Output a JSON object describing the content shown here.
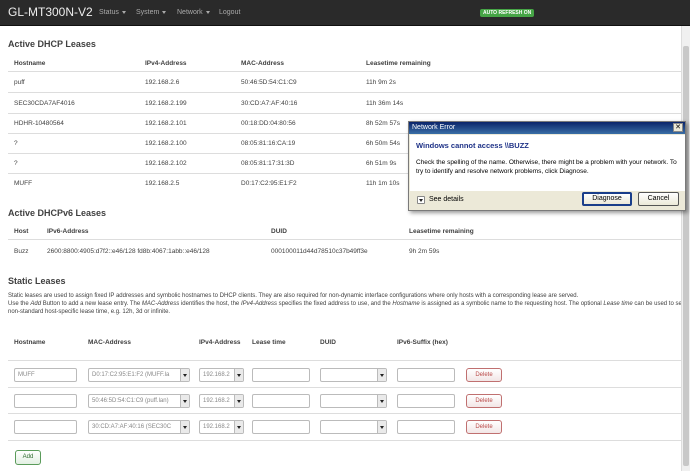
{
  "header": {
    "brand": "GL-MT300N-V2",
    "menus": [
      "Status",
      "System",
      "Network",
      "Logout"
    ],
    "auto_refresh": "AUTO REFRESH ON"
  },
  "dhcp": {
    "title": "Active DHCP Leases",
    "columns": [
      "Hostname",
      "IPv4-Address",
      "MAC-Address",
      "Leasetime remaining"
    ],
    "rows": [
      [
        "puff",
        "192.168.2.6",
        "50:46:5D:54:C1:C9",
        "11h 9m 2s"
      ],
      [
        "SEC30CDA7AF4016",
        "192.168.2.199",
        "30:CD:A7:AF:40:16",
        "11h 36m 14s"
      ],
      [
        "HDHR-10480564",
        "192.168.2.101",
        "00:18:DD:04:80:56",
        "8h 52m 57s"
      ],
      [
        "?",
        "192.168.2.100",
        "08:05:81:16:CA:19",
        "6h 50m 54s"
      ],
      [
        "?",
        "192.168.2.102",
        "08:05:81:17:31:3D",
        "6h 51m 9s"
      ],
      [
        "MUFF",
        "192.168.2.5",
        "D0:17:C2:95:E1:F2",
        "11h 1m 10s"
      ]
    ]
  },
  "dhcpv6": {
    "title": "Active DHCPv6 Leases",
    "columns": [
      "Host",
      "IPv6-Address",
      "DUID",
      "Leasetime remaining"
    ],
    "rows": [
      [
        "Buzz",
        "2600:8800:4905:d7f2::e46/128 fd8b:4067:1abb::e46/128",
        "000100011d44d78510c37b49ff3e",
        "9h 2m 59s"
      ]
    ]
  },
  "static": {
    "title": "Static Leases",
    "desc_1": "Static leases are used to assign fixed IP addresses and symbolic hostnames to DHCP clients. They are also required for non-dynamic interface configurations where only hosts with a corresponding lease are served.",
    "desc_2a": "Use the ",
    "desc_2b": "Add",
    "desc_2c": " Button to add a new lease entry. The ",
    "desc_2d": "MAC-Address",
    "desc_2e": " identifies the host, the ",
    "desc_2f": "IPv4-Address",
    "desc_2g": " specifies the fixed address to use, and the ",
    "desc_2h": "Hostname",
    "desc_2i": " is assigned as a symbolic name to the requesting host. The optional ",
    "desc_2j": "Lease time",
    "desc_2k": " can be used to set non-standard host-specific lease time, e.g. 12h, 3d or infinite.",
    "columns": [
      "Hostname",
      "MAC-Address",
      "IPv4-Address",
      "Lease time",
      "DUID",
      "IPv6-Suffix (hex)"
    ],
    "rows": [
      {
        "hostname": "MUFF",
        "mac": "D0:17:C2:95:E1:F2 (MUFF.la",
        "ipv4": "192.168.2",
        "lease": "",
        "duid": "",
        "suffix": "",
        "delete": "Delete"
      },
      {
        "hostname": "",
        "mac": "50:46:5D:54:C1:C9 (puff.lan)",
        "ipv4": "192.168.2",
        "lease": "",
        "duid": "",
        "suffix": "",
        "delete": "Delete"
      },
      {
        "hostname": "",
        "mac": "30:CD:A7:AF:40:16 (SEC30C",
        "ipv4": "192.168.2",
        "lease": "",
        "duid": "",
        "suffix": "",
        "delete": "Delete"
      }
    ],
    "add": "Add"
  },
  "dialog": {
    "title": "Network Error",
    "close": "✕",
    "heading": "Windows cannot access \\\\BUZZ",
    "message": "Check the spelling of the name. Otherwise, there might be a problem with your network. To try to identify and resolve network problems, click Diagnose.",
    "details": "See details",
    "diagnose": "Diagnose",
    "cancel": "Cancel"
  }
}
